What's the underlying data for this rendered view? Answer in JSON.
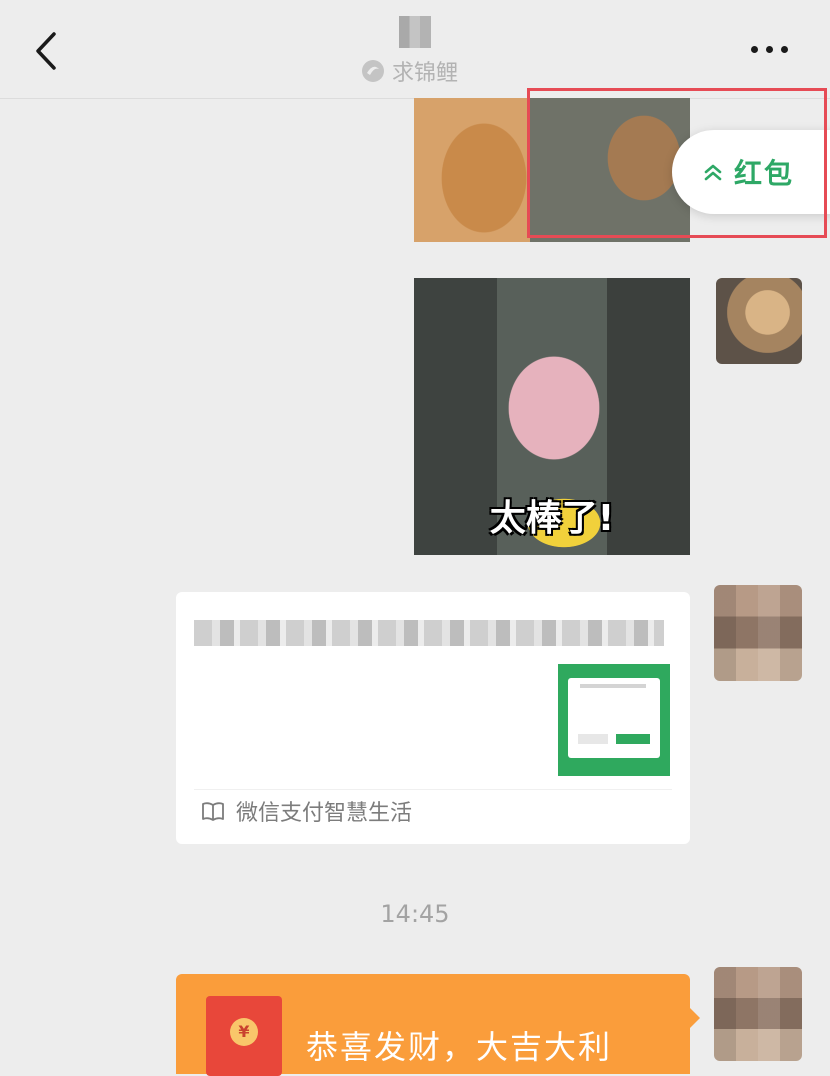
{
  "header": {
    "title": "求锦鲤",
    "icons": {
      "back": "chevron-left-icon",
      "more": "more-dots-icon",
      "title_badge": "candy-icon"
    }
  },
  "floating": {
    "hongbao_label": "红包",
    "icon": "double-chevron-up-icon",
    "accent_color": "#2ea866",
    "highlight_color": "#e64b55"
  },
  "messages": {
    "sticker_caption": "太棒了!",
    "link_card": {
      "source": "微信支付智慧生活",
      "source_icon": "book-icon"
    },
    "timestamp": "14:45",
    "red_packet": {
      "text": "恭喜发财，大吉大利",
      "coin_symbol": "¥",
      "color": "#fa9d3b"
    }
  }
}
